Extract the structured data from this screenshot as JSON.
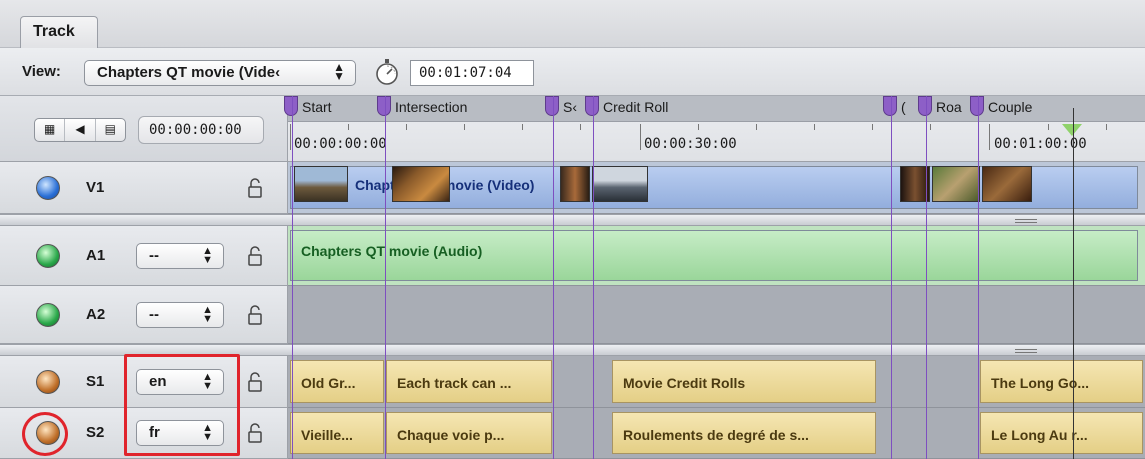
{
  "tab": {
    "label": "Track"
  },
  "viewbar": {
    "view_label": "View:",
    "view_value": "Chapters QT movie (Vide‹",
    "timecode": "00:01:07:04"
  },
  "header": {
    "timecode": "00:00:00:00"
  },
  "ruler": {
    "markers": [
      "Start",
      "Intersection",
      "S‹",
      "Credit Roll",
      "(",
      "Roa",
      "Couple"
    ],
    "times": [
      "00:00:00:00",
      "00:00:30:00",
      "00:01:00:00"
    ]
  },
  "tracks": {
    "v1": {
      "name": "V1",
      "clip": "Chapters QT movie (Video)"
    },
    "a1": {
      "name": "A1",
      "select": "--",
      "clip": "Chapters QT movie (Audio)"
    },
    "a2": {
      "name": "A2",
      "select": "--"
    },
    "s1": {
      "name": "S1",
      "select": "en",
      "clips": [
        "Old Gr...",
        "Each track can ...",
        "Movie Credit Rolls",
        "The Long Go..."
      ]
    },
    "s2": {
      "name": "S2",
      "select": "fr",
      "clips": [
        "Vieille...",
        "Chaque voie p...",
        "Roulements de degré de s...",
        "Le Long Au r..."
      ]
    }
  },
  "colors": {
    "marker": "#8d5fc7",
    "highlight": "#e0242c",
    "video_clip": "#93aedd",
    "audio_clip": "#9ad69a",
    "subtitle_clip": "#e4cf86"
  }
}
